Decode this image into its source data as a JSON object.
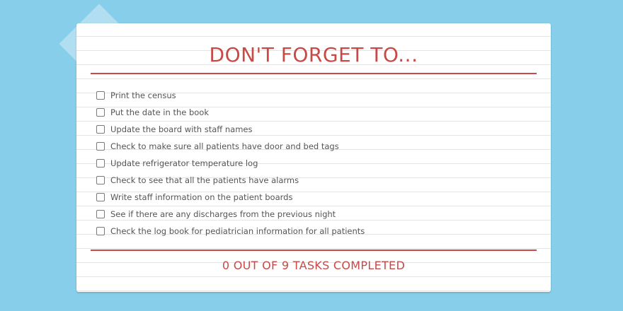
{
  "app": {
    "title": "DON'T FORGET TO...",
    "footer": "0 OUT OF 9 TASKS COMPLETED"
  },
  "colors": {
    "background": "#87ceea",
    "accent": "#c84a47",
    "card": "#ffffff"
  },
  "tasks": [
    {
      "label": "Print the census",
      "checked": false
    },
    {
      "label": "Put the date in the book",
      "checked": false
    },
    {
      "label": "Update the board with staff names",
      "checked": false
    },
    {
      "label": "Check to make sure all patients have door and bed tags",
      "checked": false
    },
    {
      "label": "Update refrigerator temperature log",
      "checked": false
    },
    {
      "label": "Check to see that all the patients have alarms",
      "checked": false
    },
    {
      "label": "Write staff information on the patient boards",
      "checked": false
    },
    {
      "label": "See if there are any discharges from the previous night",
      "checked": false
    },
    {
      "label": "Check the log book for pediatrician information for all patients",
      "checked": false
    }
  ]
}
